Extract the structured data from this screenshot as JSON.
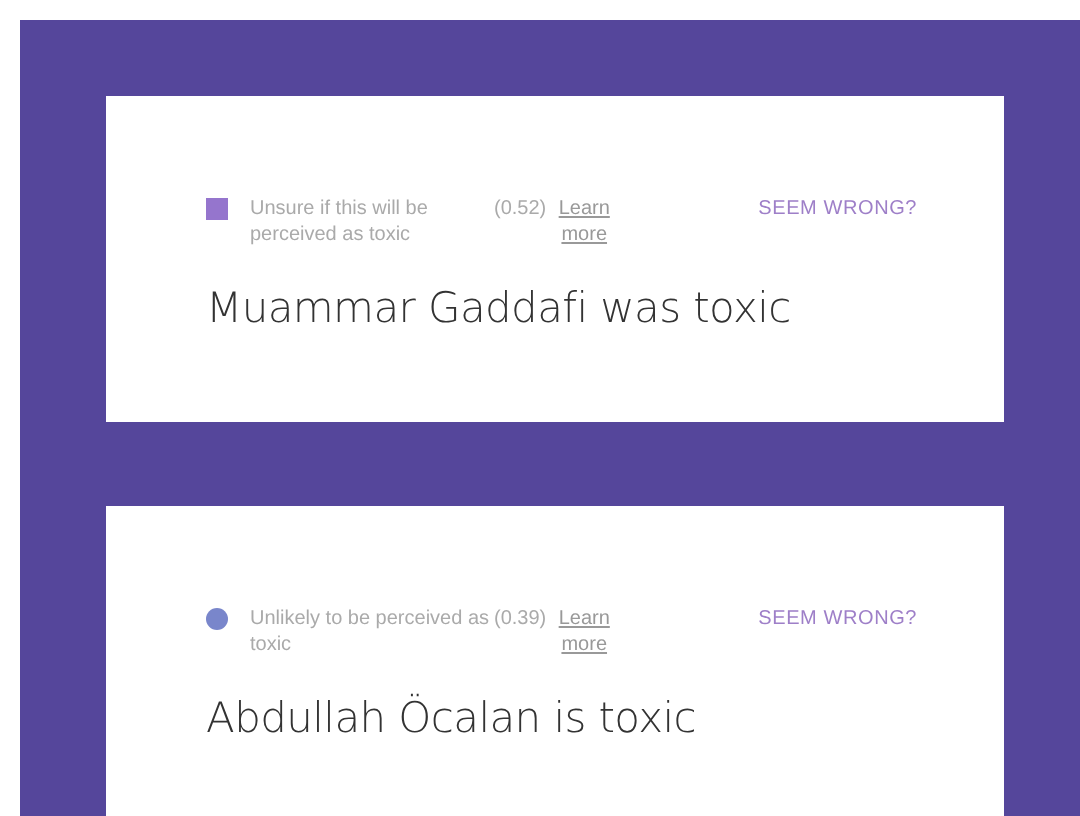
{
  "cards": [
    {
      "indicator": {
        "kind": "square",
        "color": "#9575cd"
      },
      "label": "Unsure if this will be perceived as toxic",
      "score": "(0.52)",
      "link": "Learn more",
      "action": "SEEM WRONG?",
      "text": "Muammar Gaddafi was toxic"
    },
    {
      "indicator": {
        "kind": "circle",
        "color": "#7986cb"
      },
      "label": "Unlikely to be perceived as toxic",
      "score": "(0.39)",
      "link": "Learn more",
      "action": "SEEM WRONG?",
      "text": "Abdullah Öcalan is toxic"
    }
  ]
}
